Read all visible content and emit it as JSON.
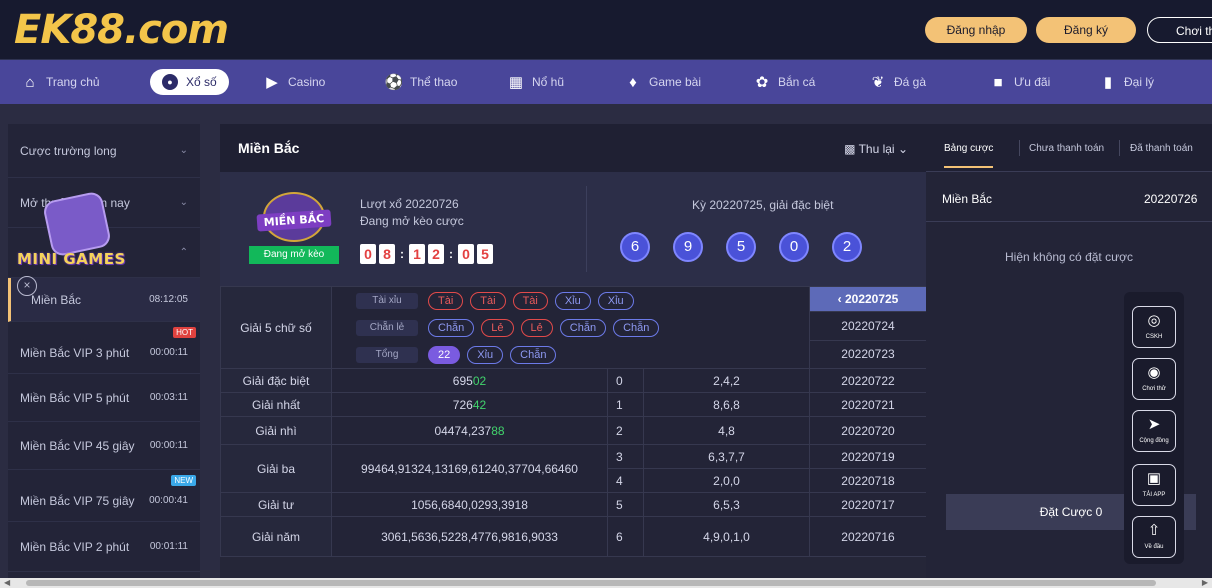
{
  "header": {
    "logo_text": "EK88.com",
    "login": "Đăng nhập",
    "register": "Đăng ký",
    "try": "Chơi th"
  },
  "nav": {
    "items": [
      {
        "label": "Trang chủ",
        "icon": "home-icon"
      },
      {
        "label": "Xổ số",
        "icon": "lottery-icon"
      },
      {
        "label": "Casino",
        "icon": "play-icon"
      },
      {
        "label": "Thể thao",
        "icon": "football-icon"
      },
      {
        "label": "Nổ hũ",
        "icon": "slot-icon"
      },
      {
        "label": "Game bài",
        "icon": "cards-icon"
      },
      {
        "label": "Bắn cá",
        "icon": "fish-icon"
      },
      {
        "label": "Đá gà",
        "icon": "rooster-icon"
      },
      {
        "label": "Ưu đãi",
        "icon": "gift-icon"
      },
      {
        "label": "Đại lý",
        "icon": "agent-icon"
      }
    ]
  },
  "sidebar": {
    "items": [
      {
        "label": "Cược trường long",
        "time": ""
      },
      {
        "label": "Mở thưởng hôm nay",
        "time": ""
      },
      {
        "label": "Miền Bắc",
        "time": "08:12:05"
      },
      {
        "label": "Miền Bắc VIP 3 phút",
        "time": "00:00:11",
        "badge": "HOT"
      },
      {
        "label": "Miền Bắc VIP 5 phút",
        "time": "00:03:11"
      },
      {
        "label": "Miền Bắc VIP 45 giây",
        "time": "00:00:11"
      },
      {
        "label": "Miền Bắc VIP 75 giây",
        "time": "00:00:41",
        "badge": "NEW"
      },
      {
        "label": "Miền Bắc VIP 2 phút",
        "time": "00:01:11"
      }
    ],
    "minigames_label": "MINI GAMES"
  },
  "main": {
    "title": "Miền Bắc",
    "collapse": "Thu lại",
    "draw_label": "Lượt xổ 20220726",
    "status_label": "Đang mở kèo cược",
    "badge_name": "MIỀN BẮC",
    "badge_open": "Đang mở kèo",
    "countdown": [
      "0",
      "8",
      "1",
      "2",
      "0",
      "5"
    ],
    "prev_label": "Kỳ 20220725, giải đặc biệt",
    "balls": [
      "6",
      "9",
      "5",
      "0",
      "2"
    ],
    "g5_name": "Giải 5 chữ số",
    "combos": [
      {
        "label": "Tài xỉu",
        "pills": [
          "Tài",
          "Tài",
          "Tài",
          "Xỉu",
          "Xỉu"
        ]
      },
      {
        "label": "Chẵn lẻ",
        "pills": [
          "Chẵn",
          "Lẻ",
          "Lẻ",
          "Chẵn",
          "Chẵn"
        ]
      },
      {
        "label": "Tổng",
        "pills": [
          "22",
          "Xỉu",
          "Chẵn"
        ]
      }
    ],
    "prizes": [
      {
        "name": "Giải đặc biệt",
        "plain": "695",
        "green": "02"
      },
      {
        "name": "Giải nhất",
        "plain": "726",
        "green": "42"
      },
      {
        "name": "Giải nhì",
        "plain": "04474,237",
        "green": "88"
      },
      {
        "name": "Giải ba",
        "value": "99464,91324,13169,61240,37704,66460"
      },
      {
        "name": "Giải tư",
        "value": "1056,6840,0293,3918"
      },
      {
        "name": "Giải năm",
        "value": "3061,5636,5228,4776,9816,9033"
      }
    ],
    "heads": [
      {
        "idx": "0",
        "val": "2,4,2"
      },
      {
        "idx": "1",
        "val": "8,6,8"
      },
      {
        "idx": "2",
        "val": "4,8"
      },
      {
        "idx": "3",
        "val": "6,3,7,7"
      },
      {
        "idx": "4",
        "val": "2,0,0"
      },
      {
        "idx": "5",
        "val": "6,5,3"
      },
      {
        "idx": "6",
        "val": "4,9,0,1,0"
      }
    ],
    "dates": [
      "20220725",
      "20220724",
      "20220723",
      "20220722",
      "20220721",
      "20220720",
      "20220719",
      "20220718",
      "20220717",
      "20220716"
    ]
  },
  "right": {
    "tabs": [
      "Bảng cược",
      "Chưa thanh toán",
      "Đã thanh toán"
    ],
    "region": "Miền Bắc",
    "date": "20220726",
    "empty": "Hiện không có đặt cược",
    "bet": "Đặt Cược 0"
  },
  "float": {
    "items": [
      {
        "label": "CSKH",
        "icon": "headset-icon"
      },
      {
        "label": "Chơi thử",
        "icon": "coin-icon"
      },
      {
        "label": "Cộng đồng",
        "icon": "send-icon"
      },
      {
        "label": "TẢI APP",
        "icon": "phone-icon"
      },
      {
        "label": "Về đầu",
        "icon": "arrow-up-icon"
      }
    ]
  },
  "colors": {
    "accent": "#f3c276",
    "nav": "#49469a",
    "ball": "#4a52d8",
    "win": "#41d36c",
    "open": "#12b85a"
  }
}
